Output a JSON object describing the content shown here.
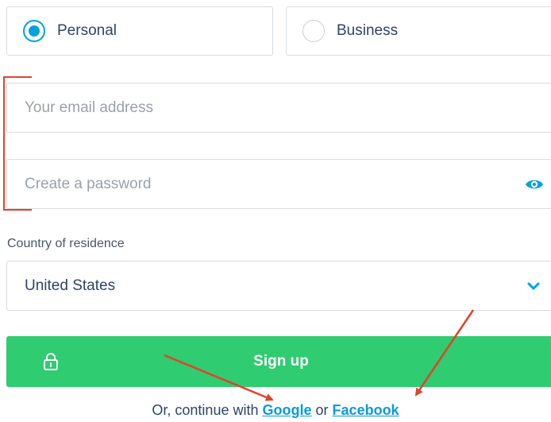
{
  "account_type": {
    "options": [
      {
        "label": "Personal",
        "selected": true
      },
      {
        "label": "Business",
        "selected": false
      }
    ]
  },
  "form": {
    "email_placeholder": "Your email address",
    "password_placeholder": "Create a password",
    "password_toggle_icon": "eye-icon",
    "country_label": "Country of residence",
    "country_value": "United States",
    "country_dropdown_icon": "chevron-down-icon"
  },
  "signup": {
    "label": "Sign up",
    "icon": "lock-icon",
    "color": "#2fcc71"
  },
  "social": {
    "prefix": "Or, continue with",
    "google": "Google",
    "separator": "or",
    "facebook": "Facebook"
  },
  "colors": {
    "accent": "#00a2dd",
    "link": "#0b9ad7",
    "annotation": "#e0442a",
    "text": "#2e4369"
  }
}
